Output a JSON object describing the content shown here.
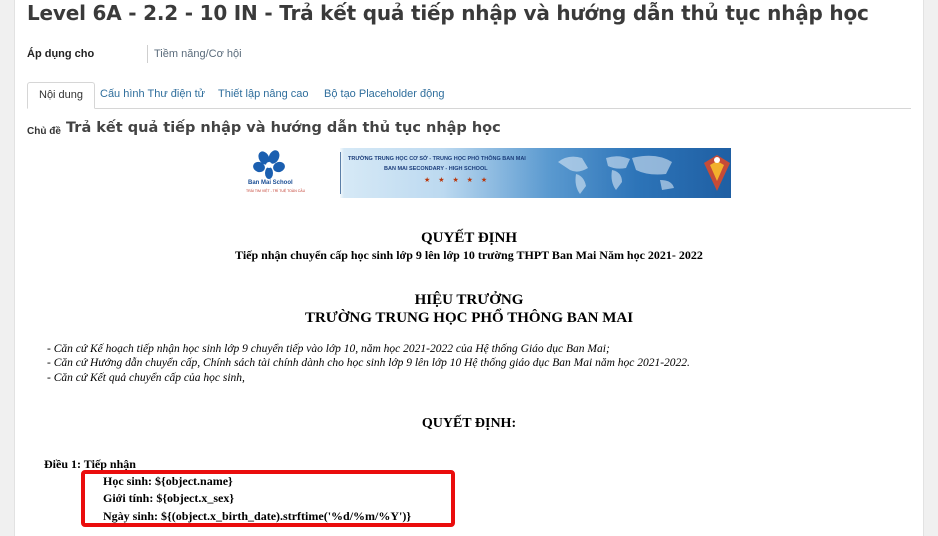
{
  "header": {
    "title": "Level 6A - 2.2 - 10 IN - Trả kết quả tiếp nhập và hướng dẫn thủ tục nhập học"
  },
  "apply": {
    "label": "Áp dụng cho",
    "value": "Tiềm năng/Cơ hội"
  },
  "tabs": [
    {
      "label": "Nội dung",
      "active": true
    },
    {
      "label": "Cấu hình Thư điện tử",
      "active": false
    },
    {
      "label": "Thiết lập nâng cao",
      "active": false
    },
    {
      "label": "Bộ tạo Placeholder động",
      "active": false
    }
  ],
  "subject": {
    "label": "Chủ đề",
    "value": "Trả kết quả tiếp nhập và hướng dẫn thủ tục nhập học"
  },
  "banner": {
    "school_name": "Ban Mai School",
    "school_tagline": "TRÁI TIM VIỆT - TRÍ TUỆ TOÀN CẦU",
    "line1": "TRƯỜNG TRUNG HỌC CƠ SỞ - TRUNG HỌC PHỔ THÔNG BAN MAI",
    "line2": "BAN MAI SECONDARY - HIGH SCHOOL",
    "stars": "★ ★ ★ ★ ★"
  },
  "document": {
    "heading": "QUYẾT ĐỊNH",
    "subheading": "Tiếp nhận chuyển cấp học sinh lớp 9 lên lớp 10 trường THPT Ban Mai Năm học 2021- 2022",
    "authority": "HIỆU TRƯỞNG",
    "school": "TRƯỜNG TRUNG HỌC PHỔ THÔNG BAN MAI",
    "basis": [
      "- Căn cứ Kế hoạch tiếp nhận học sinh lớp 9 chuyển tiếp vào lớp 10, năm học 2021-2022 của Hệ thống Giáo dục Ban Mai;",
      "- Căn cứ Hướng dẫn chuyển cấp, Chính sách tài chính dành cho học sinh lớp 9 lên lớp 10 Hệ thống giáo dục Ban Mai năm học 2021-2022.",
      "- Căn cứ Kết quả chuyển cấp của học sinh,"
    ],
    "decision": "QUYẾT ĐỊNH:",
    "article1": "Điều 1: Tiếp nhận",
    "fields": [
      "Học sinh: ${object.name}",
      "Giới tính: ${object.x_sex}",
      "Ngày sinh: ${(object.x_birth_date).strftime('%d/%m/%Y')}"
    ]
  },
  "colors": {
    "highlight_border": "#ea0d0d",
    "link": "#2f6e9c"
  }
}
